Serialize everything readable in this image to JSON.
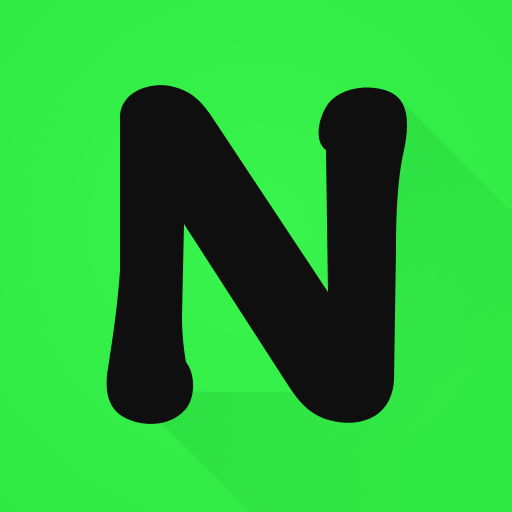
{
  "icon": {
    "name": "N",
    "colors": {
      "background": "#34f248",
      "background_edge": "#2fe843",
      "long_shadow": "#25cc38",
      "letter": "#101010"
    }
  }
}
